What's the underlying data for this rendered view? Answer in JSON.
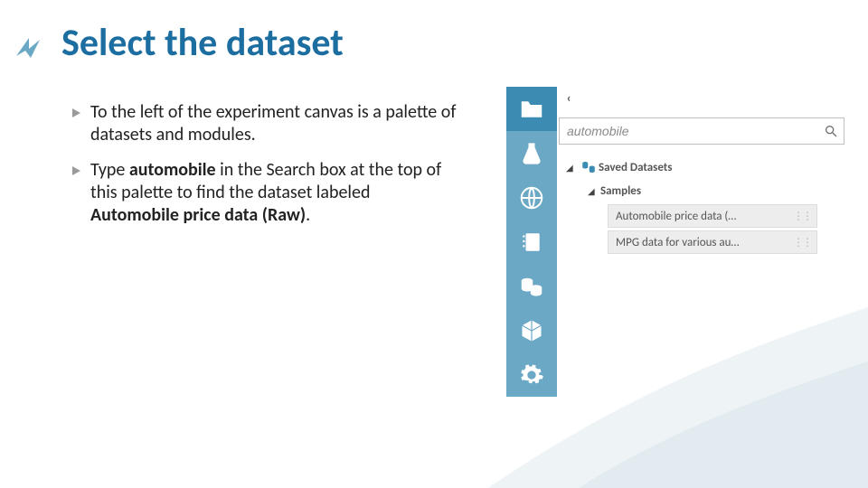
{
  "title": "Select the dataset",
  "bullets": [
    "To the left of the experiment canvas is a palette of datasets and modules.",
    "Type <b>automobile</b> in the Search box at the top of this palette to find the dataset labeled <b>Automobile price data (Raw)</b>."
  ],
  "sidebar_icons": [
    "folder",
    "flask",
    "globe",
    "notepad",
    "database",
    "cube",
    "gear"
  ],
  "collapse_glyph": "‹",
  "search": {
    "value": "automobile"
  },
  "tree": {
    "root_label": "Saved Datasets",
    "sub_label": "Samples",
    "items": [
      "Automobile price data (…",
      "MPG data for various au…"
    ]
  }
}
